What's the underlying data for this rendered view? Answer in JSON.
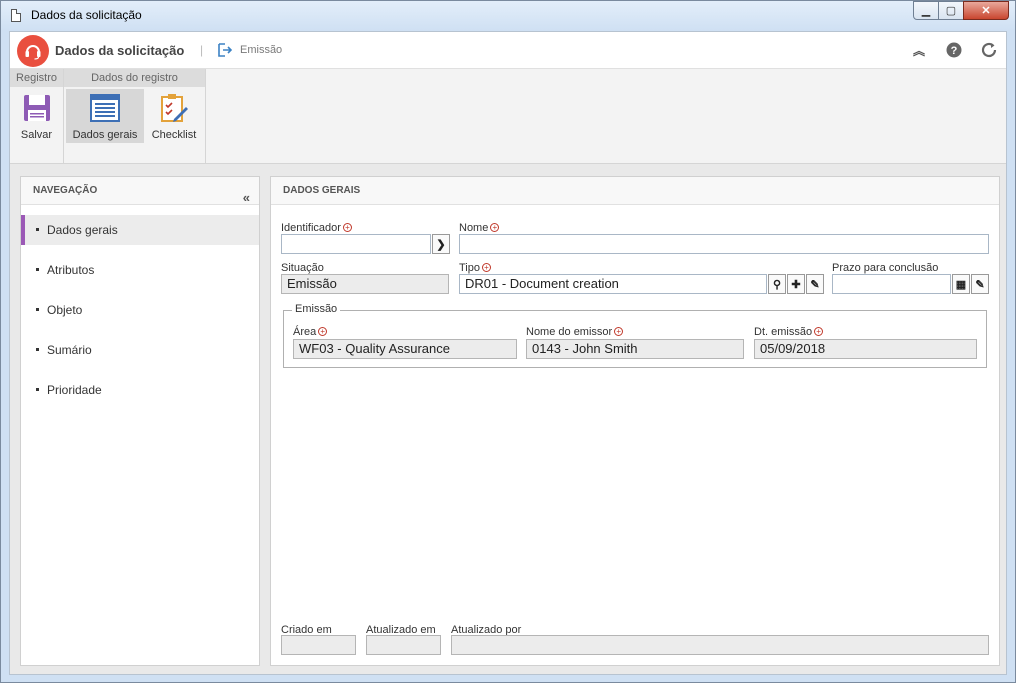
{
  "window": {
    "title": "Dados da solicitação"
  },
  "header": {
    "app_title": "Dados da solicitação",
    "separator": "|",
    "breadcrumb": "Emissão"
  },
  "ribbon": {
    "groups": [
      {
        "label": "Registro"
      },
      {
        "label": "Dados do registro"
      }
    ],
    "buttons": {
      "save": "Salvar",
      "general": "Dados gerais",
      "checklist": "Checklist"
    }
  },
  "nav": {
    "title": "NAVEGAÇÃO",
    "items": [
      {
        "label": "Dados gerais"
      },
      {
        "label": "Atributos"
      },
      {
        "label": "Objeto"
      },
      {
        "label": "Sumário"
      },
      {
        "label": "Prioridade"
      }
    ]
  },
  "form": {
    "title": "DADOS GERAIS",
    "identifier_label": "Identificador",
    "identifier_value": "",
    "name_label": "Nome",
    "name_value": "",
    "status_label": "Situação",
    "status_value": "Emissão",
    "type_label": "Tipo",
    "type_value": "DR01 - Document creation",
    "deadline_label": "Prazo para conclusão",
    "deadline_value": "",
    "issue": {
      "legend": "Emissão",
      "area_label": "Área",
      "area_value": "WF03 - Quality Assurance",
      "issuer_label": "Nome do emissor",
      "issuer_value": "0143 - John Smith",
      "date_label": "Dt. emissão",
      "date_value": "05/09/2018"
    },
    "footer": {
      "created_label": "Criado em",
      "created_value": "",
      "updated_label": "Atualizado em",
      "updated_value": "",
      "updated_by_label": "Atualizado por",
      "updated_by_value": ""
    }
  },
  "colors": {
    "accent": "#9b59b6",
    "logo": "#e94f3f",
    "required": "#c0392b"
  }
}
